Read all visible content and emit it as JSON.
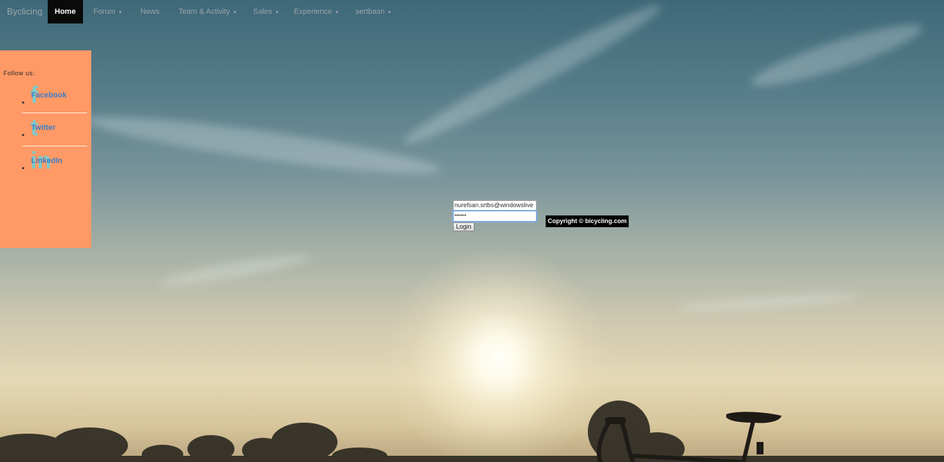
{
  "navbar": {
    "brand": "Byclicing",
    "items": [
      {
        "label": "Home",
        "caret": ""
      },
      {
        "label": "Forum",
        "caret": "▾"
      },
      {
        "label": "News",
        "caret": ""
      },
      {
        "label": "Team & Activity",
        "caret": "▾"
      },
      {
        "label": "Sales",
        "caret": "▾"
      },
      {
        "label": "Experience",
        "caret": "▾"
      },
      {
        "label": "sertbasn",
        "caret": "▾"
      }
    ]
  },
  "social": {
    "heading": "Follow us:",
    "items": [
      {
        "label": "Facebook",
        "glyph": "f",
        "icon": "facebook-icon"
      },
      {
        "label": "Twitter",
        "glyph": "t",
        "icon": "twitter-icon"
      },
      {
        "label": "LinkedIn",
        "glyph": "in",
        "icon": "linkedin-icon"
      }
    ],
    "color": "#ff9966"
  },
  "login": {
    "email_value": "nurefsan.srtbs@windowslive",
    "password_mask": "•••••••",
    "button_label": "Login"
  },
  "footer": {
    "copyright": "Copyright © bicycling.com"
  }
}
